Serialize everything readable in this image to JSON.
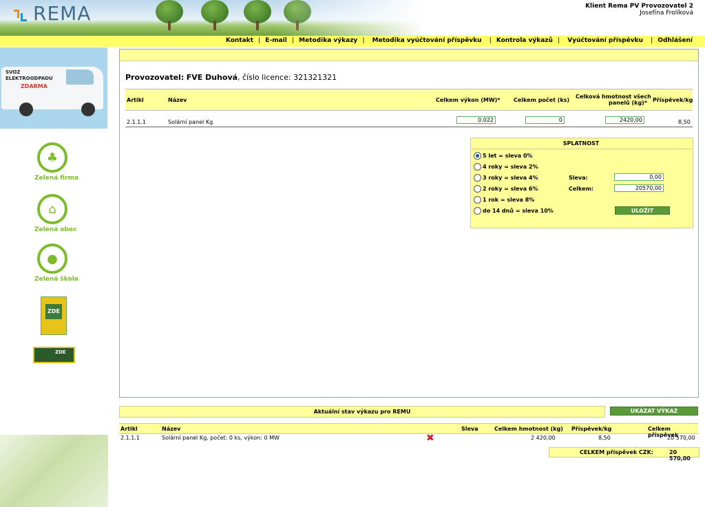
{
  "header": {
    "logo_text": "REMA",
    "client_name": "Klient Rema PV Provozovatel 2",
    "client_user": "Josefína Frolíková"
  },
  "nav": {
    "items": [
      "Kontakt",
      "E-mail",
      "Metodika výkazy",
      "Metodika vyúčtování příspěvku",
      "Kontrola výkazů",
      "Vyúčtování příspěvku",
      "Odhlášení"
    ]
  },
  "sidebar": {
    "van_text_1": "SVOZ",
    "van_text_2": "ELEKTROODPADU",
    "van_text_3": "ZDARMA",
    "zelena_firma": "Zelená firma",
    "zelena_obec": "Zelená obec",
    "zelena_skola": "Zelená škola",
    "zde_1": "ZDE",
    "zde_2": "ZDE"
  },
  "main": {
    "provozovatel_label": "Provozovatel:",
    "provozovatel_name": "FVE Duhová",
    "licence_label": ", číslo licence:",
    "licence_number": "321321321",
    "table": {
      "headers": {
        "artikl": "Artikl",
        "nazev": "Název",
        "celkem_vykon": "Celkem výkon (MW)*",
        "celkem_pocet": "Celkem počet (ks)",
        "celkova_hmotnost_1": "Celková hmotnost všech",
        "celkova_hmotnost_2": "panelů (kg)*",
        "prispevek": "Příspěvek/kg"
      },
      "row": {
        "artikl": "2.1.1.1",
        "nazev": "Solární panel Kg",
        "vykon": "0.022",
        "pocet": "0",
        "hmotnost": "2420,00",
        "prispevek": "8,50"
      }
    },
    "splatnost": {
      "title": "SPLATNOST",
      "options": [
        {
          "label": "5 let = sleva 0%",
          "checked": true
        },
        {
          "label": "4 roky = sleva 2%",
          "checked": false
        },
        {
          "label": "3 roky = sleva 4%",
          "checked": false
        },
        {
          "label": "2 roky = sleva 6%",
          "checked": false
        },
        {
          "label": "1 rok = sleva 8%",
          "checked": false
        },
        {
          "label": "do 14 dnů = sleva 10%",
          "checked": false
        }
      ],
      "sleva_label": "Sleva:",
      "sleva_value": "0,00",
      "celkem_label": "Celkem:",
      "celkem_value": "20570,00",
      "save_button": "ULOŽIT"
    }
  },
  "bottom": {
    "stav_title": "Aktuální stav výkazu pro REMU",
    "show_button": "UKÁZAT VÝKAZ",
    "headers": {
      "artikl": "Artikl",
      "nazev": "Název",
      "sleva": "Sleva",
      "celkem_hmotnost": "Celkem hmotnost (kg)",
      "prispevek_kg": "Příspěvek/kg",
      "celkem_prispevek": "Celkem příspěvek"
    },
    "row": {
      "artikl": "2.1.1.1",
      "nazev": "Solární panel Kg, počet: 0 ks, výkon: 0 MW",
      "hmotnost": "2 420,00",
      "prispevek": "8,50",
      "celkem": "20 570,00"
    },
    "total_label": "CELKEM příspěvek CZK:",
    "total_value": "20 570,00"
  },
  "colors": {
    "nav_yellow": "#ffff66",
    "panel_yellow": "#ffff99",
    "button_green": "#5a9a3a",
    "brand_green": "#7cbc2a",
    "delete_red": "#c0282a"
  }
}
